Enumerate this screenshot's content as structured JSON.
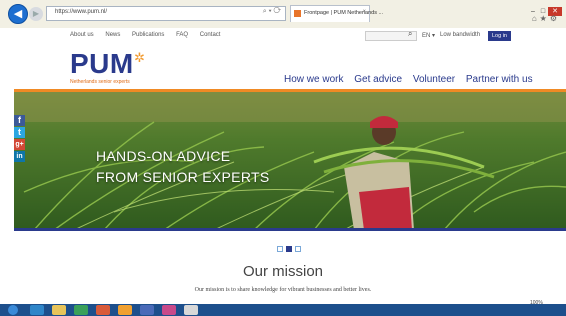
{
  "browser": {
    "address": "https://www.pum.nl/",
    "tab_title": "Frontpage | PUM Netherlands ...",
    "tab_close": "×"
  },
  "topnav": [
    "About us",
    "News",
    "Publications",
    "FAQ",
    "Contact"
  ],
  "language": "EN ▾",
  "low_bandwidth": "Low bandwidth",
  "login_label": "Log in",
  "logo_text": "PUM",
  "logo_tagline": "Netherlands senior experts",
  "main_nav": [
    "How we work",
    "Get advice",
    "Volunteer",
    "Partner with us"
  ],
  "hero": {
    "line1": "HANDS-ON ADVICE",
    "line2": "FROM SENIOR EXPERTS"
  },
  "social": [
    {
      "icon": "facebook-icon",
      "glyph": "f",
      "color": "#3b5998"
    },
    {
      "icon": "twitter-icon",
      "glyph": "t",
      "color": "#2ba6e1"
    },
    {
      "icon": "google-plus-icon",
      "glyph": "g+",
      "color": "#d34836"
    },
    {
      "icon": "linkedin-icon",
      "glyph": "in",
      "color": "#0e76a8"
    }
  ],
  "carousel_dots": 3,
  "carousel_active": 1,
  "mission": {
    "title": "Our mission",
    "text": "Our mission is to share knowledge for vibrant businesses and better lives."
  },
  "zoom": "100%",
  "colors": {
    "brand_blue": "#2a3a8c",
    "brand_orange": "#f08a24"
  }
}
